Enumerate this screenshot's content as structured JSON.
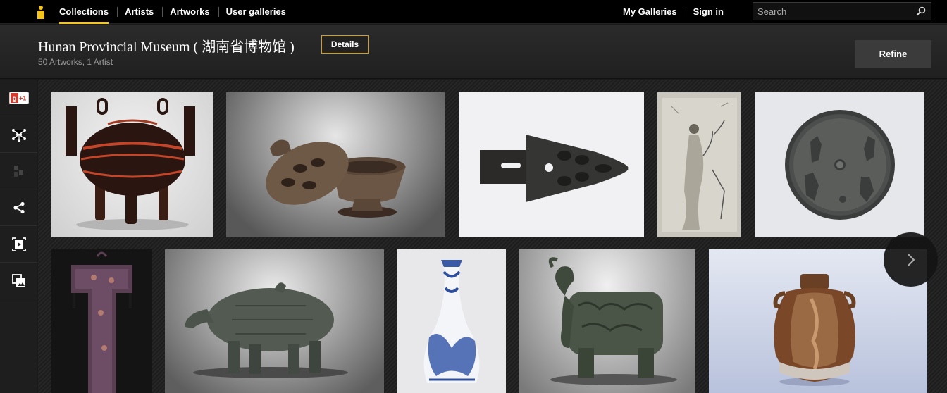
{
  "nav": {
    "left": [
      "Collections",
      "Artists",
      "Artworks",
      "User galleries"
    ],
    "right": [
      "My Galleries",
      "Sign in"
    ]
  },
  "search": {
    "placeholder": "Search",
    "value": ""
  },
  "header": {
    "title": "Hunan Provincial Museum ( 湖南省博物馆 )",
    "details_label": "Details",
    "subtitle": "50 Artworks, 1 Artist",
    "refine_label": "Refine"
  },
  "sidebar_icons": [
    "google-plus-one-icon",
    "network-icon",
    "qr-icon",
    "share-icon",
    "slideshow-icon",
    "add-to-gallery-icon"
  ],
  "sidebar": {
    "plus_one_label": "+1"
  },
  "artworks": [
    "lacquer-ding-vessel",
    "ceramic-incense-burner",
    "bronze-spearhead",
    "figure-painting-scroll",
    "bronze-mirror",
    "silk-funeral-banner",
    "bronze-boar-vessel",
    "blue-white-vase",
    "bronze-elephant-zun",
    "brown-glazed-jar"
  ],
  "colors": {
    "accent": "#f5c518",
    "background": "#1a1a1a",
    "topbar": "#000000"
  }
}
